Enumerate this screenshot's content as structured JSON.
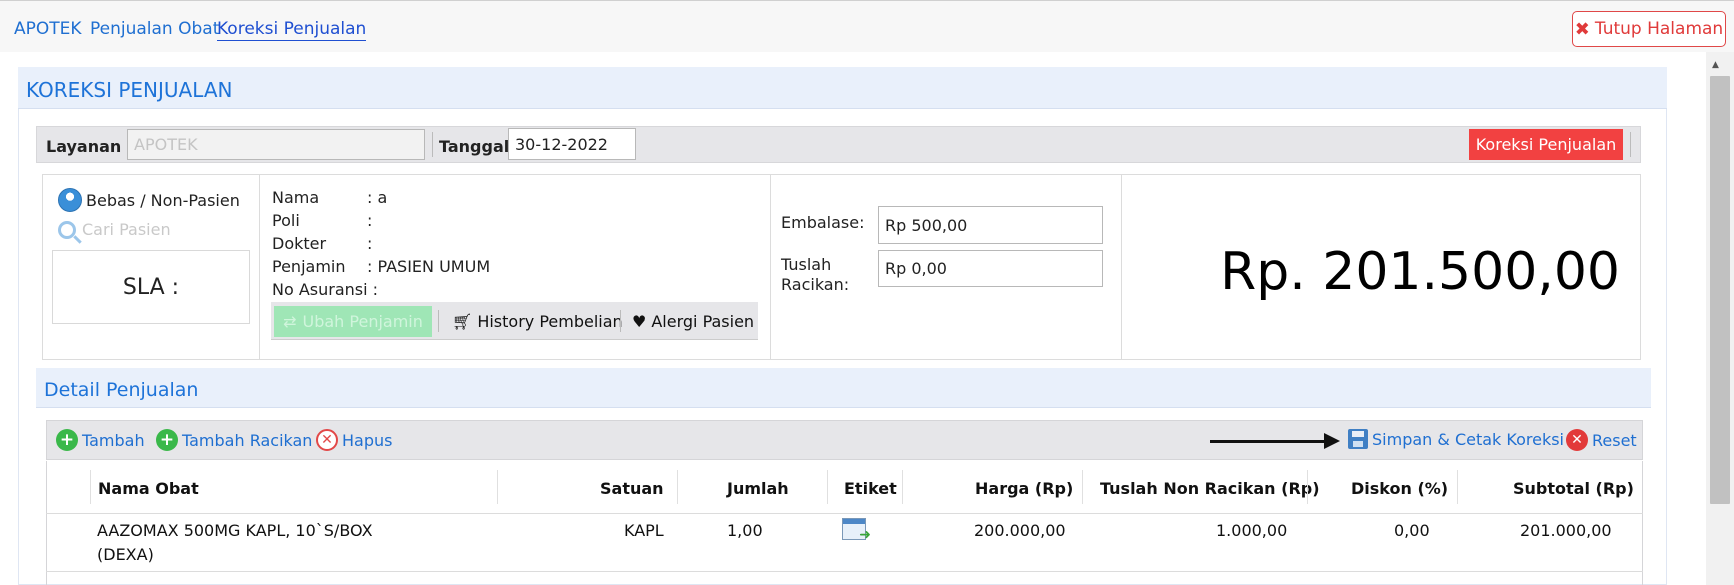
{
  "breadcrumb": [
    "APOTEK",
    "Penjualan Obat",
    "Koreksi Penjualan"
  ],
  "close_button": {
    "label": "Tutup Halaman",
    "icon": "close-icon"
  },
  "panel_title": "KOREKSI PENJUALAN",
  "filter": {
    "layanan_label": "Layanan :",
    "layanan_value": "APOTEK",
    "tanggal_label": "Tanggal :",
    "tanggal_value": "30-12-2022",
    "action_label": "Koreksi Penjualan"
  },
  "patient": {
    "type_label": "Bebas / Non-Pasien",
    "search_label": "Cari Pasien",
    "sla_label": "SLA :"
  },
  "info": {
    "nama_label": "Nama",
    "nama_value": ": a",
    "poli_label": "Poli",
    "poli_value": ":",
    "dokter_label": "Dokter",
    "dokter_value": ":",
    "penjamin_label": "Penjamin",
    "penjamin_value": ": PASIEN UMUM",
    "asuransi_label": "No Asuransi :",
    "ubah_penjamin": "Ubah Penjamin",
    "history": "History Pembelian",
    "alergi": "Alergi Pasien"
  },
  "fees": {
    "embalase_label": "Embalase:",
    "embalase_value": "Rp 500,00",
    "tuslah_label_1": "Tuslah",
    "tuslah_label_2": "Racikan:",
    "tuslah_value": "Rp 0,00"
  },
  "total": "Rp. 201.500,00",
  "detail_title": "Detail Penjualan",
  "toolbar": {
    "tambah": "Tambah",
    "tambah_racikan": "Tambah Racikan",
    "hapus": "Hapus",
    "simpan": "Simpan & Cetak Koreksi",
    "reset": "Reset"
  },
  "table": {
    "headers": [
      "Nama Obat",
      "Satuan",
      "Jumlah",
      "Etiket",
      "Harga (Rp)",
      "Tuslah Non Racikan (Rp)",
      "Diskon (%)",
      "Subtotal (Rp)"
    ],
    "rows": [
      {
        "nama_line1": "AAZOMAX 500MG KAPL, 10`S/BOX",
        "nama_line2": "(DEXA)",
        "satuan": "KAPL",
        "jumlah": "1,00",
        "harga": "200.000,00",
        "tuslah": "1.000,00",
        "diskon": "0,00",
        "subtotal": "201.000,00"
      }
    ]
  },
  "colors": {
    "accent": "#1e73d8",
    "danger": "#f24141",
    "success": "#3ab84a"
  }
}
